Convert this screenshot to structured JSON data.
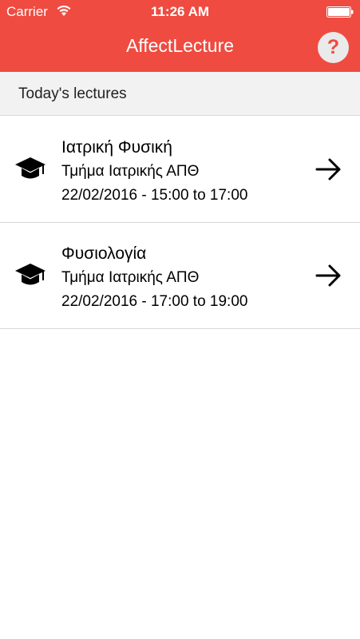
{
  "status_bar": {
    "carrier": "Carrier",
    "time": "11:26 AM"
  },
  "app": {
    "title": "AffectLecture",
    "help_label": "?",
    "accent_color": "#ef4b40"
  },
  "section": {
    "title": "Today's lectures"
  },
  "lectures": [
    {
      "icon": "graduation-cap-icon",
      "name": "Ιατρική Φυσική",
      "department": "Τμήμα Ιατρικής ΑΠΘ",
      "datetime": "22/02/2016 - 15:00 to 17:00"
    },
    {
      "icon": "graduation-cap-icon",
      "name": "Φυσιολογία",
      "department": "Τμήμα Ιατρικής ΑΠΘ",
      "datetime": "22/02/2016 - 17:00 to 19:00"
    }
  ]
}
